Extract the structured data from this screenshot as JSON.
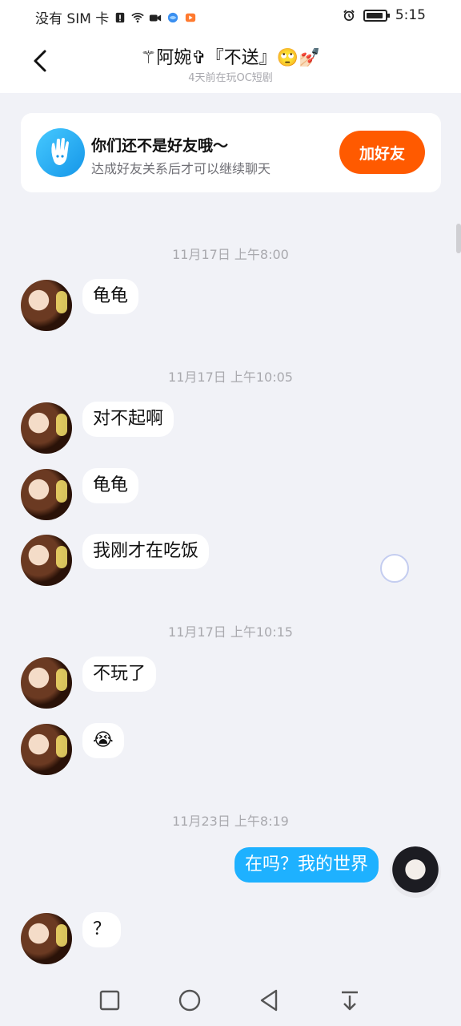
{
  "status_bar": {
    "carrier": "没有 SIM 卡",
    "time": "5:15"
  },
  "header": {
    "title": "⚚阿婉✞『不送』🙄💅🏻",
    "subtitle": "4天前在玩OC短剧"
  },
  "friend_card": {
    "title": "你们还不是好友哦～",
    "subtitle": "达成好友关系后才可以继续聊天",
    "button": "加好友"
  },
  "messages": [
    {
      "type": "time",
      "text": "11月17日 上午8:00"
    },
    {
      "type": "in",
      "text": "龟龟"
    },
    {
      "type": "time",
      "text": "11月17日 上午10:05"
    },
    {
      "type": "in",
      "text": "对不起啊"
    },
    {
      "type": "in",
      "text": "龟龟"
    },
    {
      "type": "in",
      "text": "我刚才在吃饭"
    },
    {
      "type": "time",
      "text": "11月17日 上午10:15"
    },
    {
      "type": "in",
      "text": "不玩了"
    },
    {
      "type": "in",
      "text": "😭"
    },
    {
      "type": "time",
      "text": "11月23日 上午8:19"
    },
    {
      "type": "out",
      "text": "在吗？我的世界"
    },
    {
      "type": "in",
      "text": "？"
    }
  ],
  "colors": {
    "accent_orange": "#ff5a00",
    "bubble_blue": "#1eb1ff",
    "background": "#f1f2f7"
  }
}
